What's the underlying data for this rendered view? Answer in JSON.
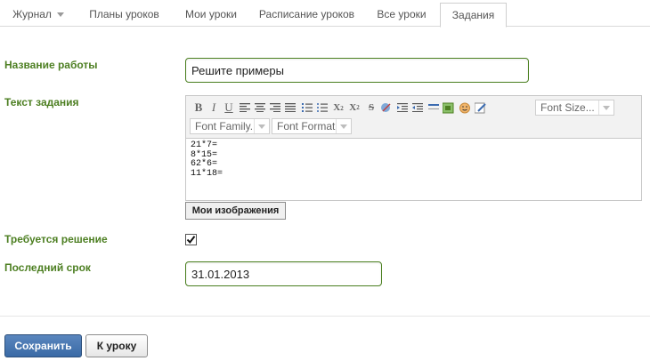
{
  "tabs": {
    "journal": "Журнал",
    "lesson_plans": "Планы уроков",
    "my_lessons": "Мои уроки",
    "schedule": "Расписание уроков",
    "all_lessons": "Все уроки",
    "assignments": "Задания",
    "active": "Задания"
  },
  "form": {
    "work_name_label": "Название работы",
    "work_name_value": "Решите примеры",
    "task_text_label": "Текст задания",
    "task_lines": [
      "21*7=",
      "8*15=",
      "62*6=",
      "11*18="
    ],
    "solution_required_label": "Требуется решение",
    "solution_required_checked": true,
    "deadline_label": "Последний срок",
    "deadline_value": "31.01.2013"
  },
  "editor": {
    "font_size": "Font Size...",
    "font_family": "Font Family.",
    "font_format": "Font Format",
    "my_images": "Мои изображения",
    "toolbar_icons": [
      "bold-icon",
      "italic-icon",
      "underline-icon",
      "align-left-icon",
      "align-center-icon",
      "align-right-icon",
      "align-justify-icon",
      "ordered-list-icon",
      "unordered-list-icon",
      "subscript-icon",
      "superscript-icon",
      "strikethrough-icon",
      "remove-format-icon",
      "outdent-icon",
      "indent-icon",
      "horizontal-rule-icon",
      "insert-image-icon",
      "emoticon-icon",
      "edit-source-icon"
    ]
  },
  "actions": {
    "save": "Сохранить",
    "to_lesson": "К уроку"
  },
  "colors": {
    "label_green": "#4d7f22",
    "input_border": "#4a7f1f",
    "save_button": "#3a6aa6"
  }
}
